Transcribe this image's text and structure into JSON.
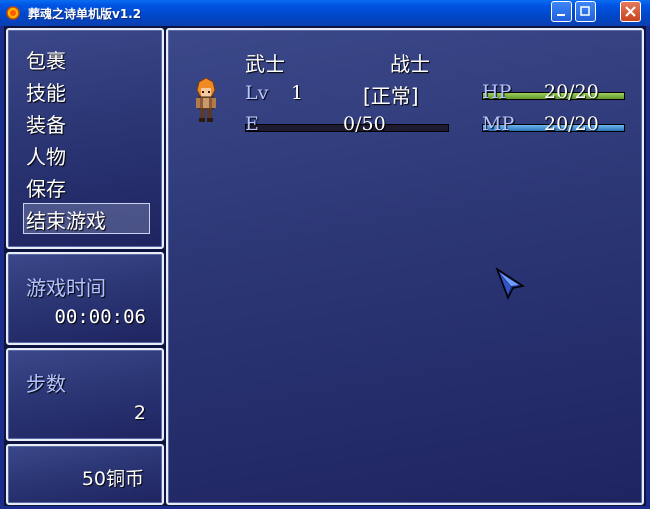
{
  "window": {
    "title": "葬魂之诗单机版v1.2",
    "controls": [
      "minimize",
      "restore",
      "close"
    ]
  },
  "menu": {
    "items": [
      "包裹",
      "技能",
      "装备",
      "人物",
      "保存",
      "结束游戏"
    ],
    "selected_index": 5
  },
  "playtime": {
    "label": "游戏时间",
    "value": "00:00:06"
  },
  "steps": {
    "label": "步数",
    "value": "2"
  },
  "gold": {
    "value": "50铜币"
  },
  "character": {
    "name": "武士",
    "class": "战士",
    "level_label": "Lv",
    "level": "1",
    "status": "[正常]",
    "exp_label": "E",
    "exp_text": "0/50",
    "exp_fraction": 0.0,
    "hp_label": "HP",
    "hp_text": "20/20",
    "hp_fraction": 1.0,
    "mp_label": "MP",
    "mp_text": "20/20",
    "mp_fraction": 1.0
  },
  "colors": {
    "hp_bar": "#6ea83a",
    "mp_bar": "#3f8fd0",
    "label_blue": "#b5c4ff",
    "window_border": "#e8ecf6"
  }
}
